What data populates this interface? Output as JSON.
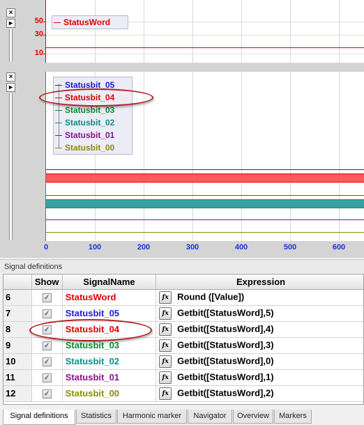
{
  "top_chart": {
    "y_ticks": [
      "50",
      "30",
      "10"
    ],
    "legend": [
      {
        "label": "StatusWord",
        "color": "#e00000"
      }
    ]
  },
  "bottom_chart": {
    "legend": [
      {
        "label": "Statusbit_05",
        "color": "#1c1cd0"
      },
      {
        "label": "Statusbit_04",
        "color": "#e00000"
      },
      {
        "label": "Statusbit_03",
        "color": "#0a8a2a"
      },
      {
        "label": "Statusbit_02",
        "color": "#108a8a"
      },
      {
        "label": "Statusbit_01",
        "color": "#8a108a"
      },
      {
        "label": "Statusbit_00",
        "color": "#8a8a10"
      }
    ],
    "x_ticks": [
      "0",
      "100",
      "200",
      "300",
      "400",
      "500",
      "600"
    ]
  },
  "side_buttons": {
    "close": "×",
    "expand": "▸"
  },
  "signal_panel": {
    "title": "Signal definitions",
    "columns": {
      "show": "Show",
      "name": "SignalName",
      "expression": "Expression"
    },
    "fx_label": "fx",
    "check_glyph": "✓",
    "rows": [
      {
        "idx": "6",
        "name": "StatusWord",
        "color": "#e00000",
        "expression": "Round ([Value])",
        "show": true
      },
      {
        "idx": "7",
        "name": "Statusbit_05",
        "color": "#1c1cd0",
        "expression": "Getbit([StatusWord],5)",
        "show": true
      },
      {
        "idx": "8",
        "name": "Statusbit_04",
        "color": "#e00000",
        "expression": "Getbit([StatusWord],4)",
        "show": true
      },
      {
        "idx": "9",
        "name": "Statusbit_03",
        "color": "#0a8a2a",
        "expression": "Getbit([StatusWord],3)",
        "show": true
      },
      {
        "idx": "10",
        "name": "Statusbit_02",
        "color": "#108a8a",
        "expression": "Getbit([StatusWord],0)",
        "show": true
      },
      {
        "idx": "11",
        "name": "Statusbit_01",
        "color": "#8a108a",
        "expression": "Getbit([StatusWord],1)",
        "show": true
      },
      {
        "idx": "12",
        "name": "Statusbit_00",
        "color": "#8a8a10",
        "expression": "Getbit([StatusWord],2)",
        "show": true
      }
    ]
  },
  "tabs": [
    {
      "label": "Signal definitions",
      "active": true
    },
    {
      "label": "Statistics",
      "active": false
    },
    {
      "label": "Harmonic marker",
      "active": false
    },
    {
      "label": "Navigator",
      "active": false
    },
    {
      "label": "Overview",
      "active": false
    },
    {
      "label": "Markers",
      "active": false
    }
  ]
}
